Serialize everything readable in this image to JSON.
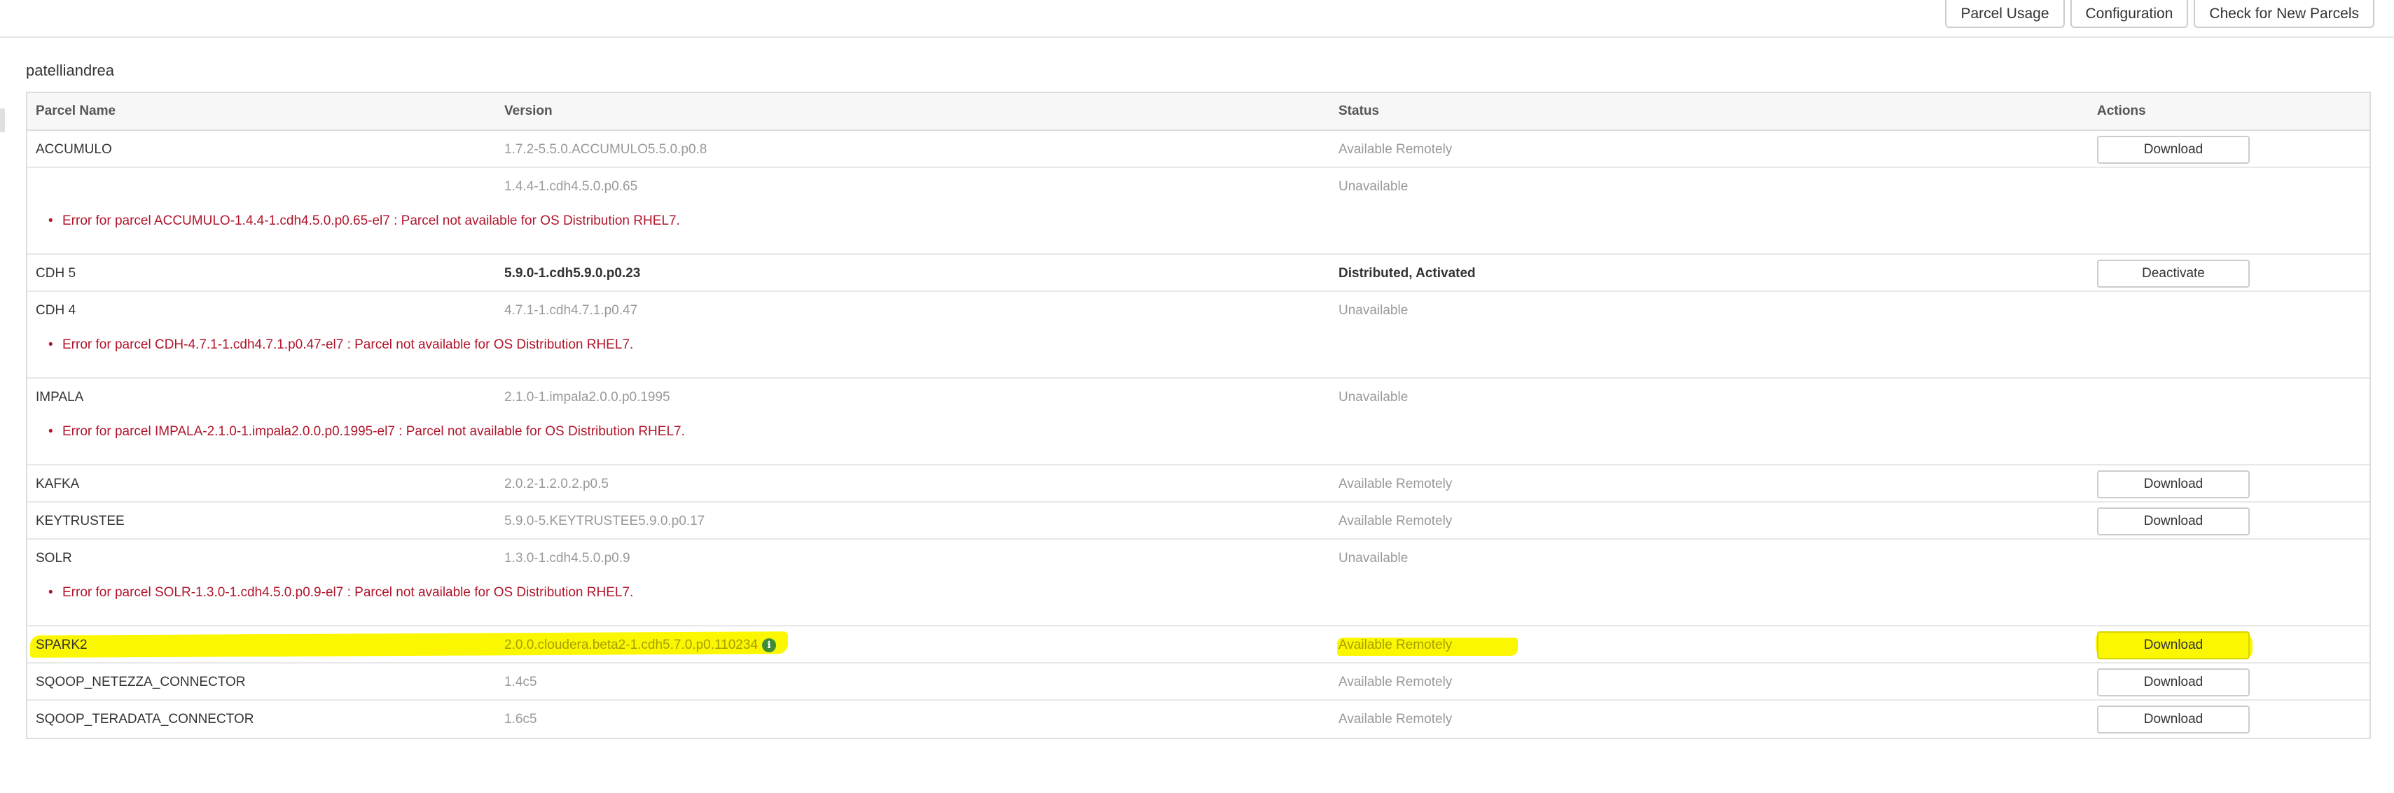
{
  "toolbar": {
    "parcel_usage": "Parcel Usage",
    "configuration": "Configuration",
    "check_new": "Check for New Parcels"
  },
  "host": {
    "title": "patelliandrea"
  },
  "table": {
    "headers": {
      "name": "Parcel Name",
      "version": "Version",
      "status": "Status",
      "actions": "Actions"
    },
    "rows": [
      {
        "name": "ACCUMULO",
        "version": "1.7.2-5.5.0.ACCUMULO5.5.0.p0.8",
        "status": "Available Remotely",
        "action": "Download"
      },
      {
        "name": "",
        "version": "1.4.4-1.cdh4.5.0.p0.65",
        "status": "Unavailable",
        "action": ""
      },
      {
        "error": "Error for parcel ACCUMULO-1.4.4-1.cdh4.5.0.p0.65-el7 : Parcel not available for OS Distribution RHEL7."
      },
      {
        "name": "CDH 5",
        "version": "5.9.0-1.cdh5.9.0.p0.23",
        "status": "Distributed, Activated",
        "action": "Deactivate"
      },
      {
        "name": "CDH 4",
        "version": "4.7.1-1.cdh4.7.1.p0.47",
        "status": "Unavailable",
        "action": ""
      },
      {
        "error": "Error for parcel CDH-4.7.1-1.cdh4.7.1.p0.47-el7 : Parcel not available for OS Distribution RHEL7."
      },
      {
        "name": "IMPALA",
        "version": "2.1.0-1.impala2.0.0.p0.1995",
        "status": "Unavailable",
        "action": ""
      },
      {
        "error": "Error for parcel IMPALA-2.1.0-1.impala2.0.0.p0.1995-el7 : Parcel not available for OS Distribution RHEL7."
      },
      {
        "name": "KAFKA",
        "version": "2.0.2-1.2.0.2.p0.5",
        "status": "Available Remotely",
        "action": "Download"
      },
      {
        "name": "KEYTRUSTEE",
        "version": "5.9.0-5.KEYTRUSTEE5.9.0.p0.17",
        "status": "Available Remotely",
        "action": "Download"
      },
      {
        "name": "SOLR",
        "version": "1.3.0-1.cdh4.5.0.p0.9",
        "status": "Unavailable",
        "action": ""
      },
      {
        "error": "Error for parcel SOLR-1.3.0-1.cdh4.5.0.p0.9-el7 : Parcel not available for OS Distribution RHEL7."
      },
      {
        "name": "SPARK2",
        "version": "2.0.0.cloudera.beta2-1.cdh5.7.0.p0.110234",
        "status": "Available Remotely",
        "action": "Download",
        "info_icon": "info-icon"
      },
      {
        "name": "SQOOP_NETEZZA_CONNECTOR",
        "version": "1.4c5",
        "status": "Available Remotely",
        "action": "Download"
      },
      {
        "name": "SQOOP_TERADATA_CONNECTOR",
        "version": "1.6c5",
        "status": "Available Remotely",
        "action": "Download"
      }
    ]
  },
  "colors": {
    "error": "#b0152b",
    "highlight": "#fbf700",
    "info_icon": "#3d8c3a"
  }
}
